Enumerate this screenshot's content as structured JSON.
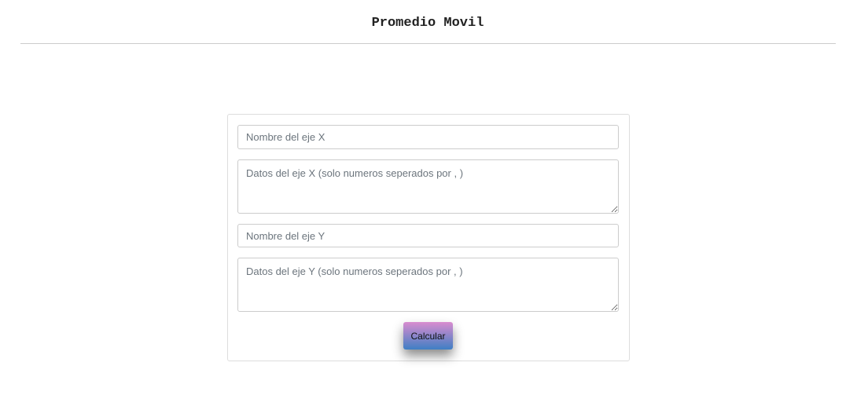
{
  "title": "Promedio Movil",
  "form": {
    "x_name_placeholder": "Nombre del eje X",
    "x_data_placeholder": "Datos del eje X (solo numeros seperados por , )",
    "y_name_placeholder": "Nombre del eje Y",
    "y_data_placeholder": "Datos del eje Y (solo numeros seperados por , )",
    "submit_label": "Calcular"
  }
}
